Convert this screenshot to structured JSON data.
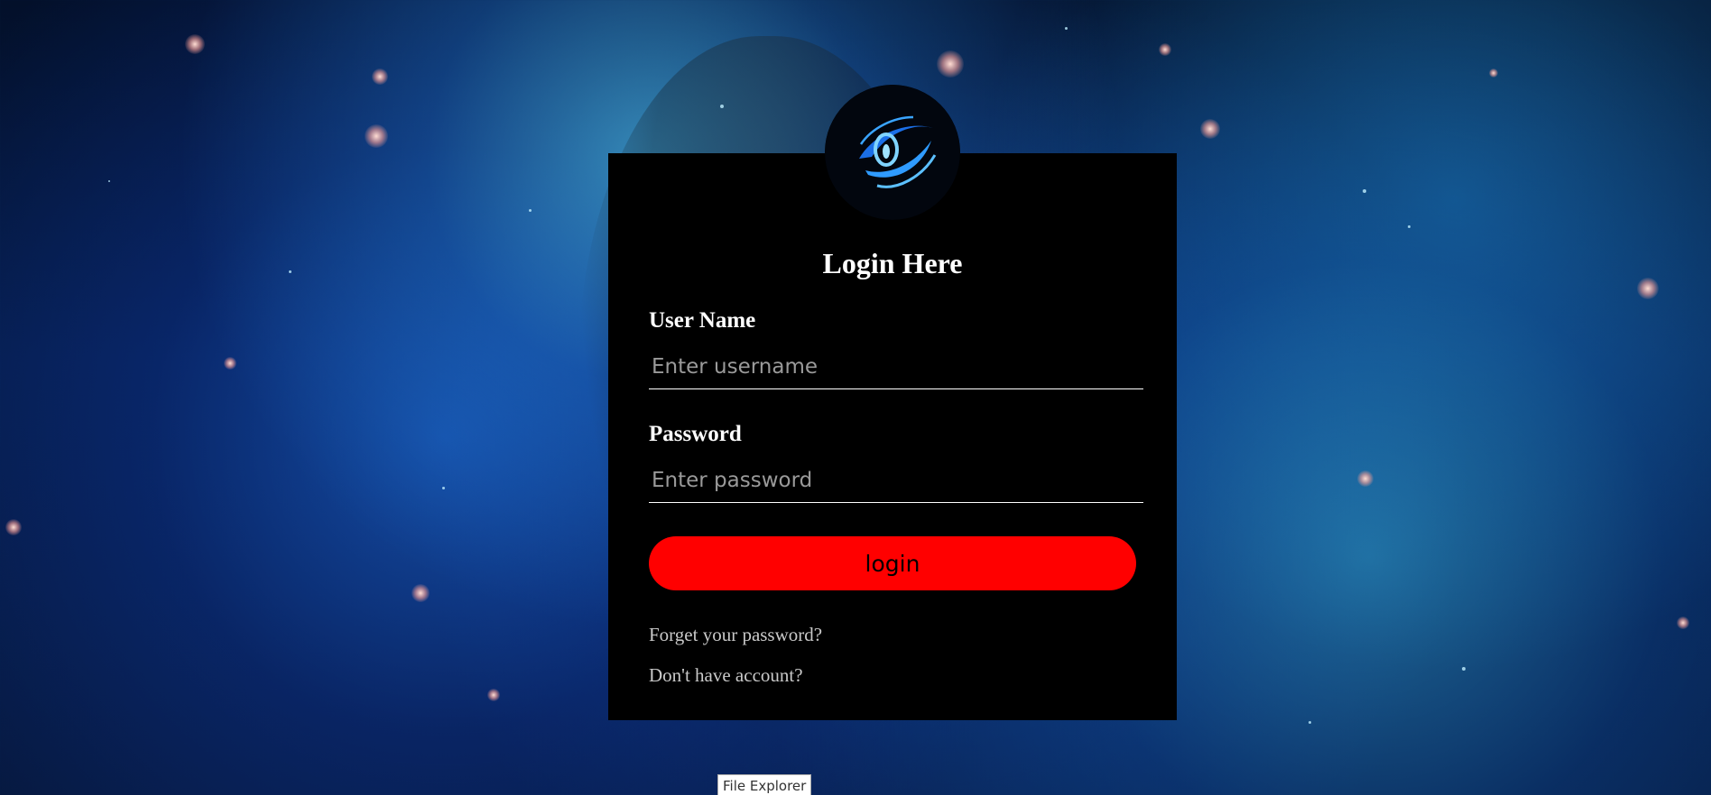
{
  "page": {
    "background_theme": "blue-nebula-space"
  },
  "logo": {
    "icon": "blue-eye-logo-icon"
  },
  "login_form": {
    "title": "Login Here",
    "username": {
      "label": "User Name",
      "placeholder": "Enter username",
      "value": ""
    },
    "password": {
      "label": "Password",
      "placeholder": "Enter password",
      "value": ""
    },
    "submit_label": "login",
    "forgot_password_link": "Forget your password?",
    "register_link": "Don't have account?"
  },
  "tooltip": {
    "text": "File Explorer"
  },
  "colors": {
    "card_background": "#000000",
    "button_background": "#ff0000",
    "button_text": "#000000",
    "title_text": "#ffffff",
    "link_text": "#c9c9c9",
    "placeholder_text": "#9a9a9a"
  }
}
